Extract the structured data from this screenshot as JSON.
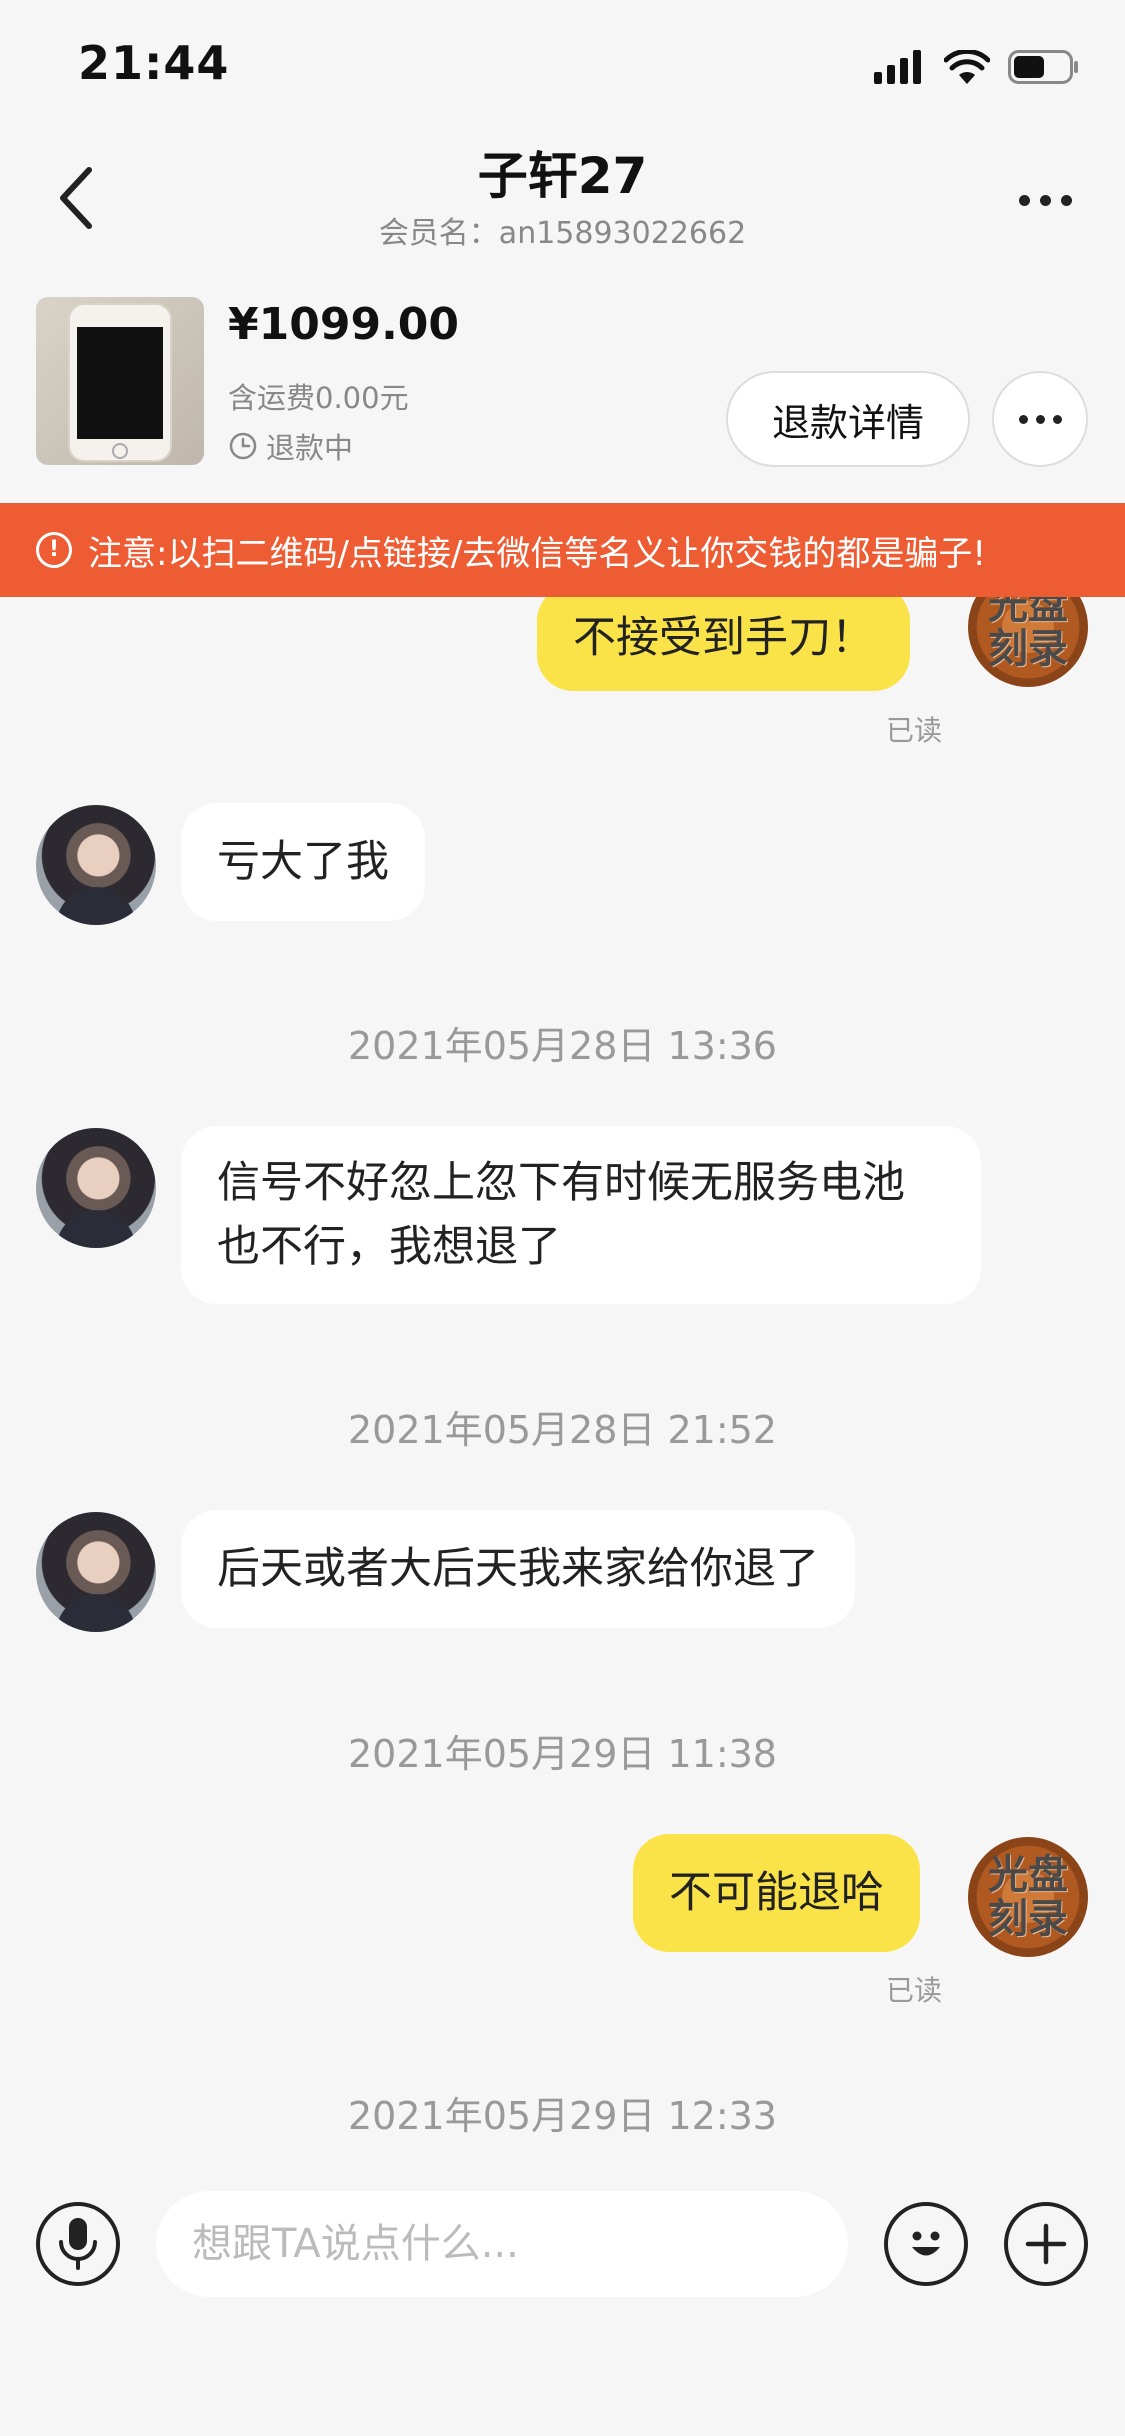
{
  "status_bar": {
    "time": "21:44"
  },
  "header": {
    "title": "子轩27",
    "subtitle": "会员名：an15893022662"
  },
  "product": {
    "price": "¥1099.00",
    "shipping": "含运费0.00元",
    "status": "退款中",
    "refund_button": "退款详情"
  },
  "warning": {
    "text": "注意:以扫二维码/点链接/去微信等名义让你交钱的都是骗子!"
  },
  "self_avatar_text": [
    "光盘",
    "刻录"
  ],
  "messages": [
    {
      "type": "out",
      "text": "不接受到手刀！",
      "receipt": "已读"
    },
    {
      "type": "in",
      "text": "亏大了我"
    },
    {
      "type": "time",
      "text": "2021年05月28日 13:36"
    },
    {
      "type": "in",
      "text": "信号不好忽上忽下有时候无服务电池也不行，我想退了"
    },
    {
      "type": "time",
      "text": "2021年05月28日 21:52"
    },
    {
      "type": "in",
      "text": "后天或者大后天我来家给你退了"
    },
    {
      "type": "time",
      "text": "2021年05月29日 11:38"
    },
    {
      "type": "out",
      "text": "不可能退哈",
      "receipt": "已读"
    },
    {
      "type": "time",
      "text": "2021年05月29日 12:33"
    }
  ],
  "input": {
    "placeholder": "想跟TA说点什么..."
  }
}
